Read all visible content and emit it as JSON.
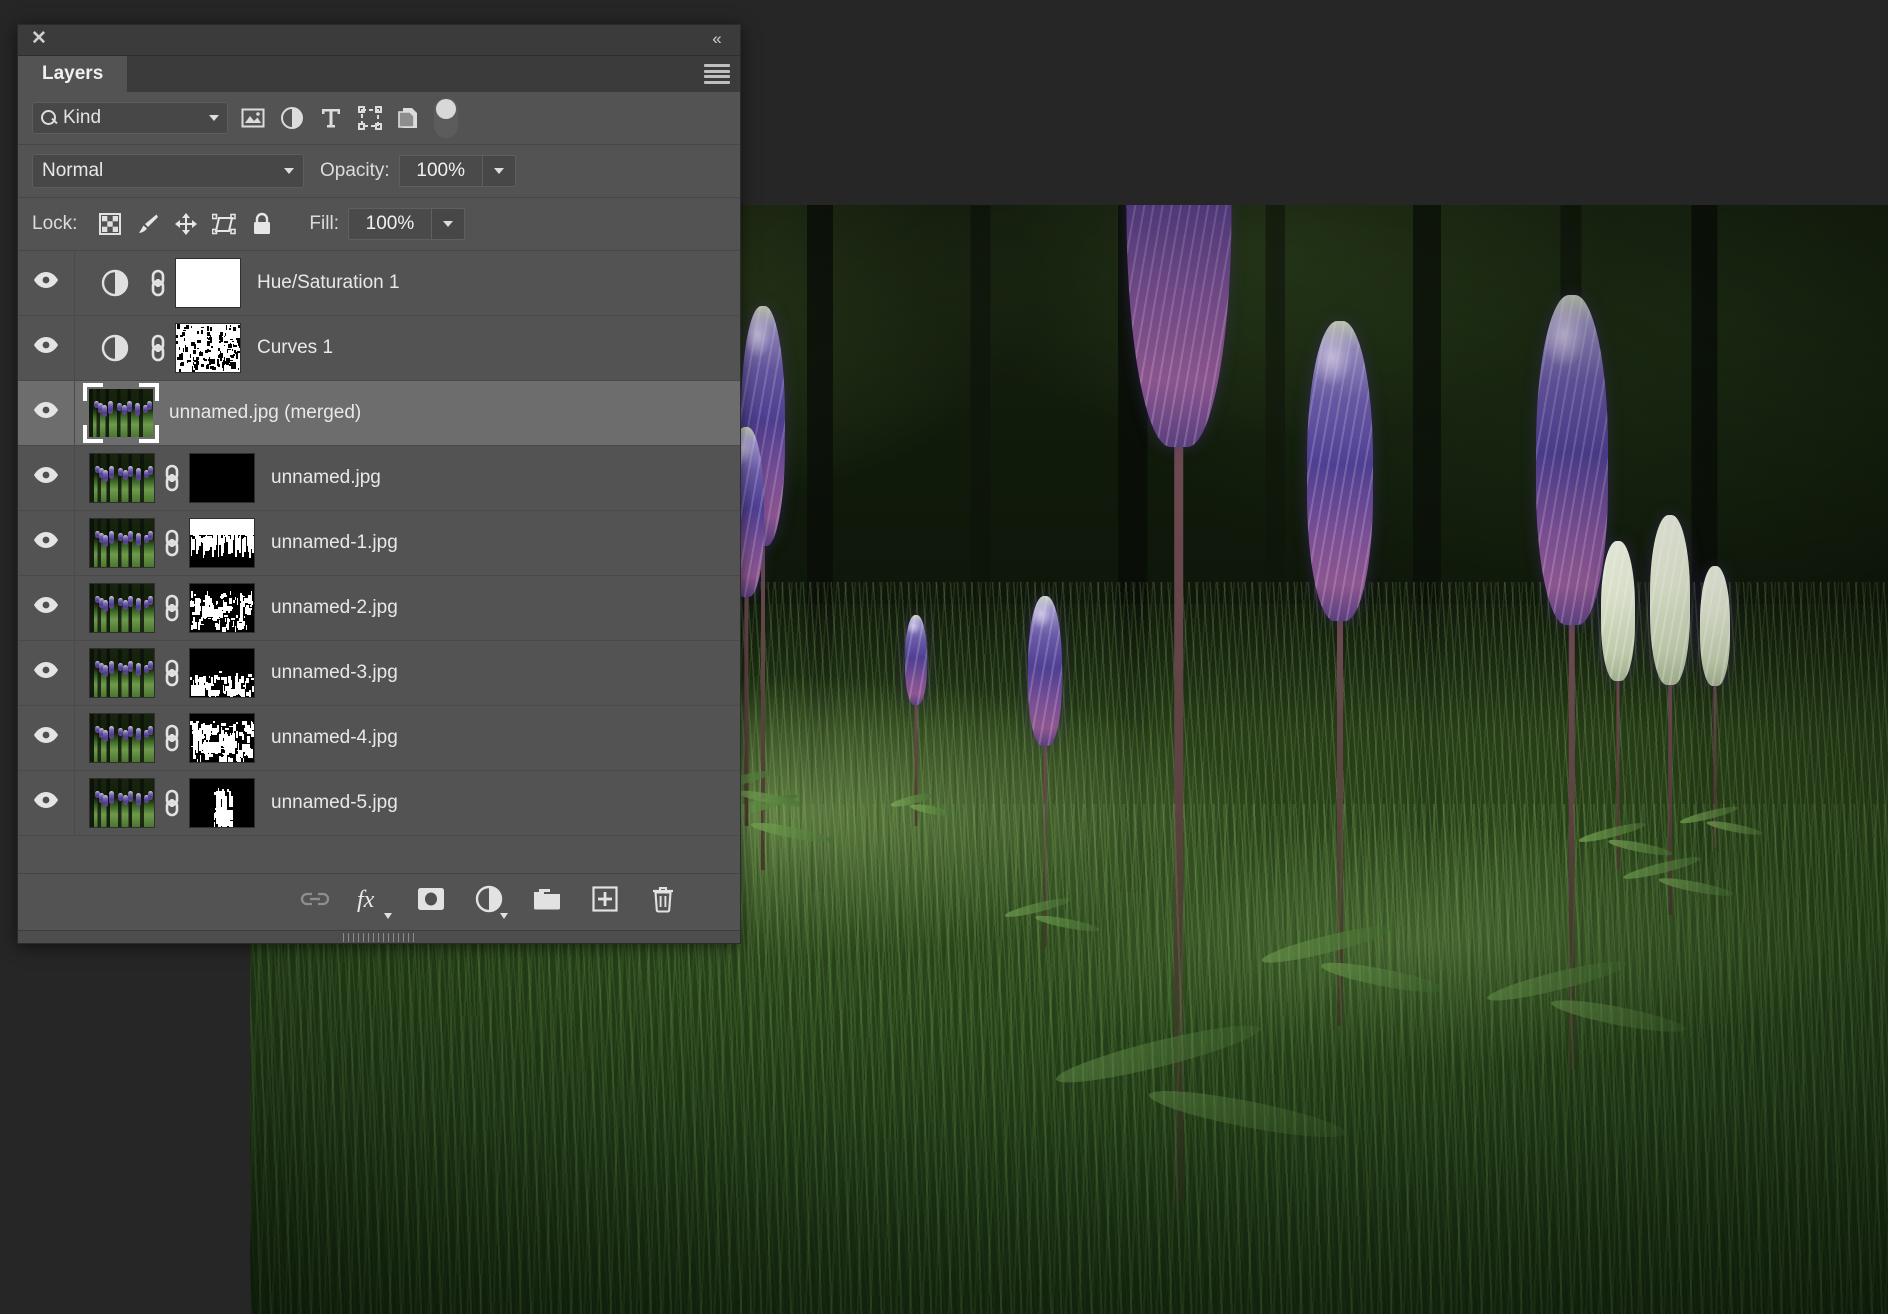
{
  "panel": {
    "close_icon": "close-icon",
    "collapse_icon": "collapse-double-chevron-icon",
    "menu_icon": "panel-menu-icon",
    "tab_label": "Layers"
  },
  "filter": {
    "search_icon": "search-icon",
    "kind_label": "Kind",
    "kind_chevron": "chevron-down-icon",
    "icons": [
      {
        "name": "filter-pixel-layers-icon",
        "title": "Pixel layers"
      },
      {
        "name": "filter-adjustment-layers-icon",
        "title": "Adjustment layers"
      },
      {
        "name": "filter-type-layers-icon",
        "title": "Type layers"
      },
      {
        "name": "filter-shape-layers-icon",
        "title": "Shape layers"
      },
      {
        "name": "filter-smart-objects-icon",
        "title": "Smart objects"
      }
    ],
    "toggle_name": "filter-enable-toggle"
  },
  "blend": {
    "mode": "Normal",
    "mode_chevron": "chevron-down-icon",
    "opacity_label": "Opacity:",
    "opacity_value": "100%",
    "opacity_chevron": "chevron-down-icon"
  },
  "lock": {
    "label": "Lock:",
    "items": [
      {
        "name": "lock-transparent-pixels-icon"
      },
      {
        "name": "lock-image-pixels-icon"
      },
      {
        "name": "lock-position-icon"
      },
      {
        "name": "lock-artboard-nesting-icon"
      },
      {
        "name": "lock-all-icon"
      }
    ],
    "fill_label": "Fill:",
    "fill_value": "100%",
    "fill_chevron": "chevron-down-icon"
  },
  "layers": [
    {
      "name": "Hue/Saturation 1",
      "visible": true,
      "selected": false,
      "kind": "adjustment",
      "mask": "white",
      "linked": true
    },
    {
      "name": "Curves 1",
      "visible": true,
      "selected": false,
      "kind": "adjustment",
      "mask": "speckle-light",
      "linked": true
    },
    {
      "name": "unnamed.jpg (merged)",
      "visible": true,
      "selected": true,
      "kind": "pixel",
      "mask": null,
      "linked": false
    },
    {
      "name": "unnamed.jpg",
      "visible": true,
      "selected": false,
      "kind": "pixel",
      "mask": "black",
      "linked": true
    },
    {
      "name": "unnamed-1.jpg",
      "visible": true,
      "selected": false,
      "kind": "pixel",
      "mask": "treeline",
      "linked": true
    },
    {
      "name": "unnamed-2.jpg",
      "visible": true,
      "selected": false,
      "kind": "pixel",
      "mask": "scatter-mid",
      "linked": true
    },
    {
      "name": "unnamed-3.jpg",
      "visible": true,
      "selected": false,
      "kind": "pixel",
      "mask": "scatter-low",
      "linked": true
    },
    {
      "name": "unnamed-4.jpg",
      "visible": true,
      "selected": false,
      "kind": "pixel",
      "mask": "scatter-dense",
      "linked": true
    },
    {
      "name": "unnamed-5.jpg",
      "visible": true,
      "selected": false,
      "kind": "pixel",
      "mask": "narrow-band",
      "linked": true
    }
  ],
  "bottom_toolbar": [
    {
      "name": "link-layers-button",
      "icon": "link-icon",
      "dimmed": true,
      "caret": false
    },
    {
      "name": "layer-style-button",
      "icon": "fx-icon",
      "dimmed": false,
      "caret": true
    },
    {
      "name": "add-layer-mask-button",
      "icon": "layer-mask-icon",
      "dimmed": false,
      "caret": false
    },
    {
      "name": "new-adjustment-layer-button",
      "icon": "adjustment-icon",
      "dimmed": false,
      "caret": true
    },
    {
      "name": "new-group-button",
      "icon": "folder-icon",
      "dimmed": false,
      "caret": false
    },
    {
      "name": "new-layer-button",
      "icon": "new-layer-plus-icon",
      "dimmed": false,
      "caret": false
    },
    {
      "name": "delete-layer-button",
      "icon": "trash-icon",
      "dimmed": false,
      "caret": false
    }
  ],
  "canvas": {
    "image_description": "Lupine flowers in a sunlit forest meadow"
  },
  "colors": {
    "panel_bg": "#535353",
    "panel_header": "#3b3b3b",
    "selected_row": "#6d6d6d",
    "text": "#e8e8e8",
    "field_bg": "#474747",
    "desktop_bg": "#262626"
  }
}
